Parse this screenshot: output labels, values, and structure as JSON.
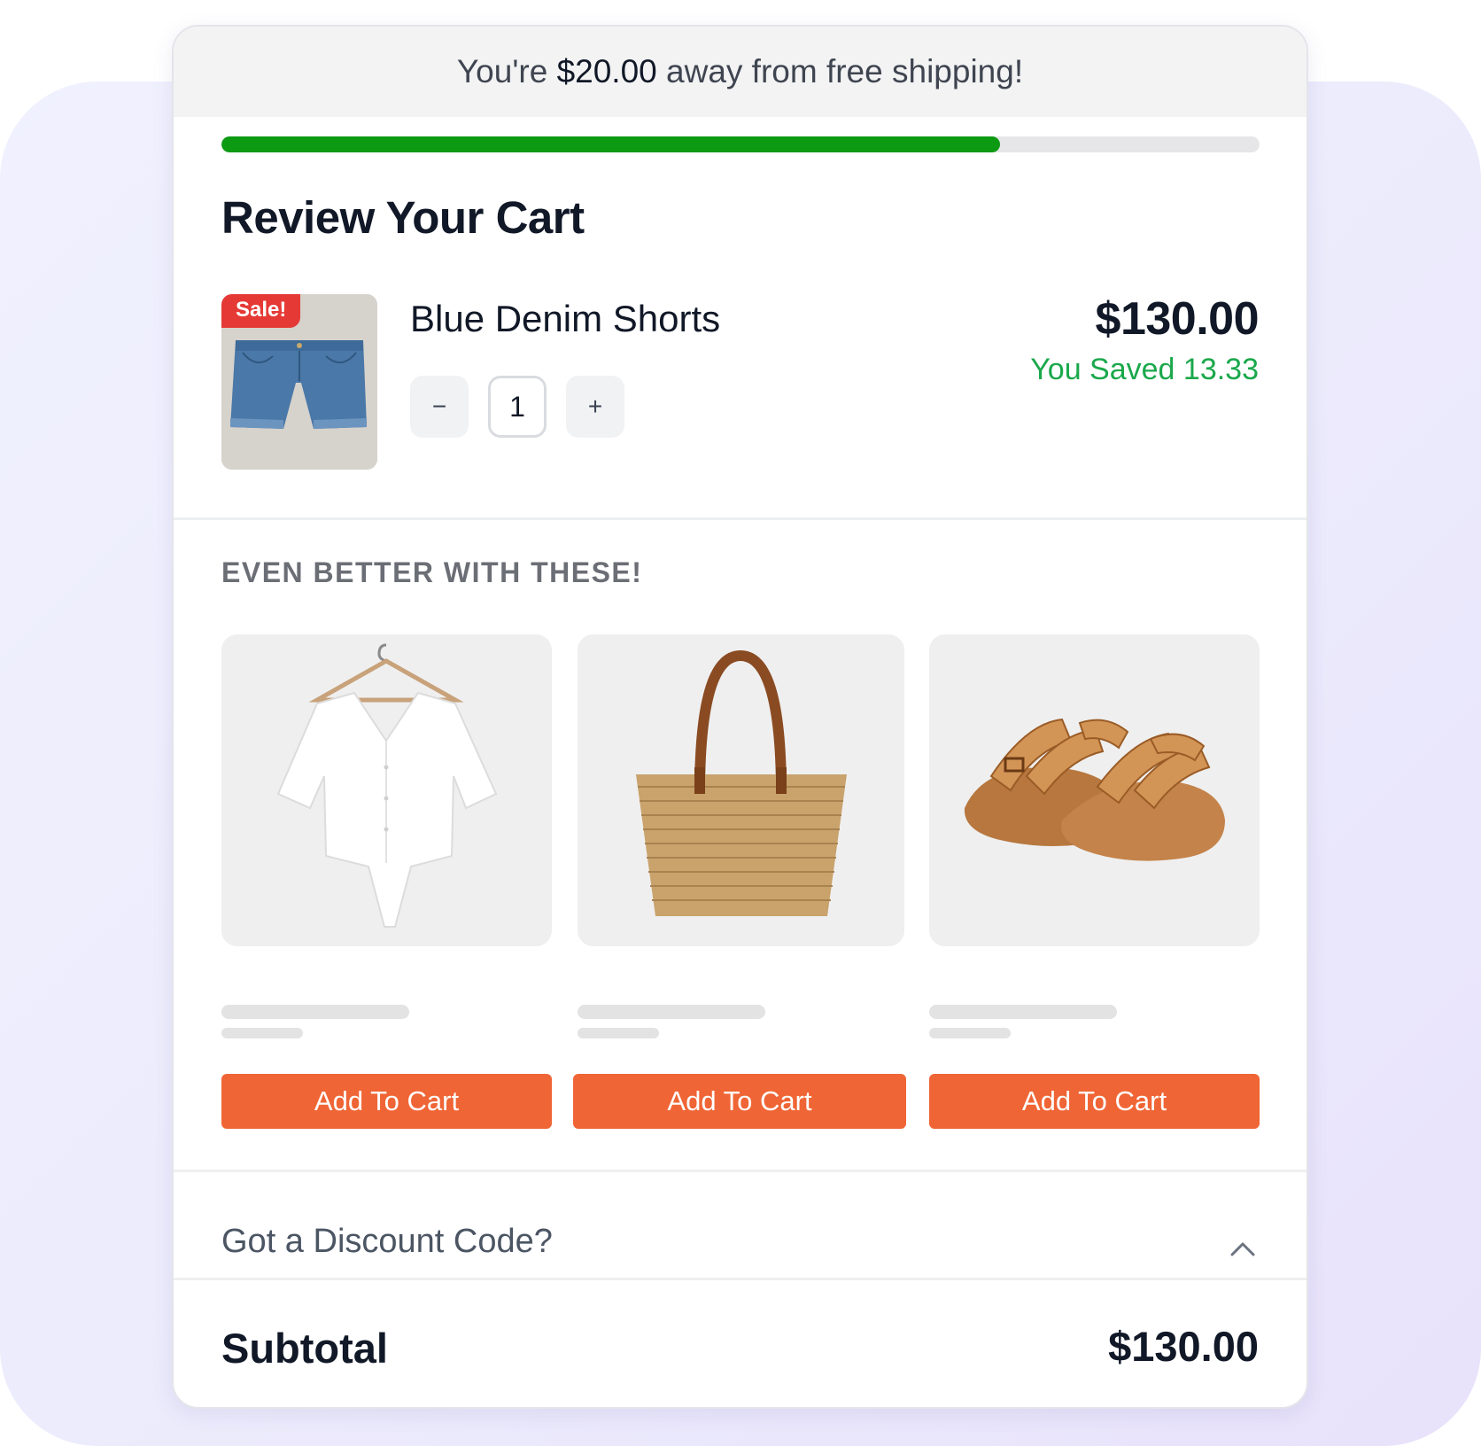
{
  "shipping_banner": {
    "prefix": "You're",
    "amount": "$20.00",
    "suffix": "away from free shipping!",
    "progress_fraction": 0.75,
    "progress_color": "#0c9a12"
  },
  "cart": {
    "title": "Review Your Cart",
    "item": {
      "badge": "Sale!",
      "name": "Blue Denim Shorts",
      "image_icon": "denim-shorts-image",
      "quantity": "1",
      "decrement_symbol": "−",
      "increment_symbol": "+",
      "price": "$130.00",
      "saved_text": "You Saved 13.33"
    }
  },
  "upsell": {
    "heading": "EVEN BETTER WITH THESE!",
    "products": [
      {
        "image_icon": "white-blouse-image",
        "button_label": "Add To Cart"
      },
      {
        "image_icon": "straw-tote-bag-image",
        "button_label": "Add To Cart"
      },
      {
        "image_icon": "leather-sandals-image",
        "button_label": "Add To Cart"
      }
    ]
  },
  "discount": {
    "label": "Got a Discount Code?",
    "icon": "chevron-up-icon"
  },
  "summary": {
    "subtotal_label": "Subtotal",
    "subtotal_value": "$130.00"
  },
  "colors": {
    "accent_button": "#f06535",
    "savings_text": "#1aa84b",
    "sale_badge": "#e53935"
  }
}
